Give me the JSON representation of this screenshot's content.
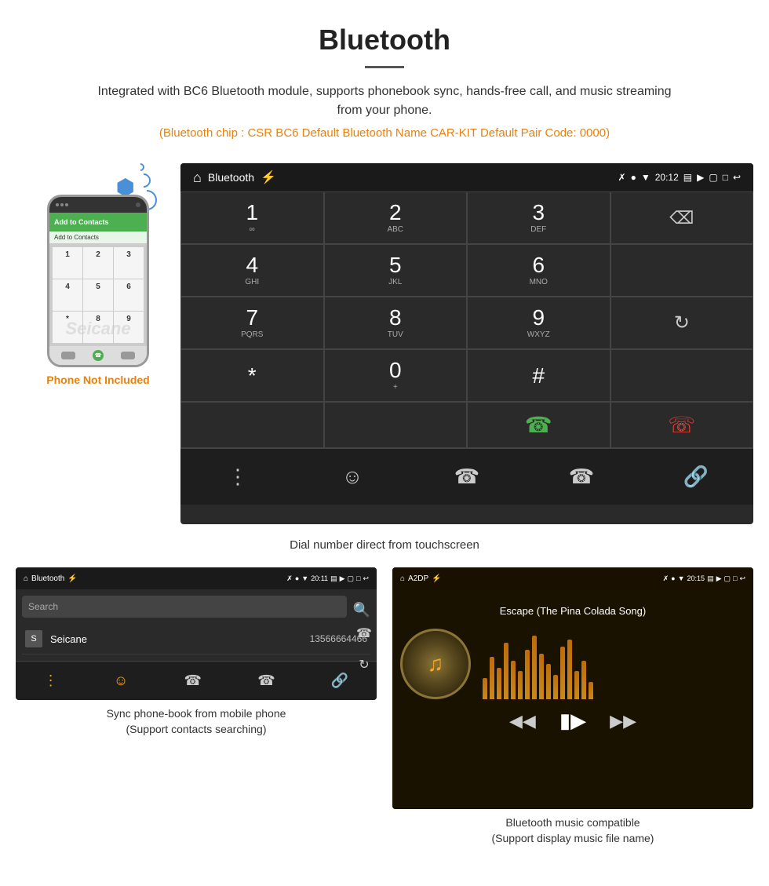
{
  "header": {
    "title": "Bluetooth",
    "description": "Integrated with BC6 Bluetooth module, supports phonebook sync, hands-free call, and music streaming from your phone.",
    "specs": "(Bluetooth chip : CSR BC6   Default Bluetooth Name CAR-KIT   Default Pair Code: 0000)"
  },
  "phone_mockup": {
    "not_included_label": "Phone Not Included",
    "watermark": "Seicane"
  },
  "dialer_screen": {
    "statusbar": {
      "app_name": "Bluetooth",
      "time": "20:12"
    },
    "keys": [
      {
        "num": "1",
        "letters": "∞"
      },
      {
        "num": "2",
        "letters": "ABC"
      },
      {
        "num": "3",
        "letters": "DEF"
      },
      {
        "num": "4",
        "letters": "GHI"
      },
      {
        "num": "5",
        "letters": "JKL"
      },
      {
        "num": "6",
        "letters": "MNO"
      },
      {
        "num": "7",
        "letters": "PQRS"
      },
      {
        "num": "8",
        "letters": "TUV"
      },
      {
        "num": "9",
        "letters": "WXYZ"
      },
      {
        "num": "*",
        "letters": ""
      },
      {
        "num": "0",
        "letters": "+"
      },
      {
        "num": "#",
        "letters": ""
      }
    ]
  },
  "dialer_caption": "Dial number direct from touchscreen",
  "phonebook_screen": {
    "statusbar": {
      "app_name": "Bluetooth",
      "time": "20:11"
    },
    "search_placeholder": "Search",
    "contacts": [
      {
        "letter": "S",
        "name": "Seicane",
        "number": "13566664466"
      }
    ]
  },
  "phonebook_caption_line1": "Sync phone-book from mobile phone",
  "phonebook_caption_line2": "(Support contacts searching)",
  "music_screen": {
    "statusbar": {
      "app_name": "A2DP",
      "time": "20:15"
    },
    "song_title": "Escape (The Pina Colada Song)"
  },
  "music_caption_line1": "Bluetooth music compatible",
  "music_caption_line2": "(Support display music file name)"
}
